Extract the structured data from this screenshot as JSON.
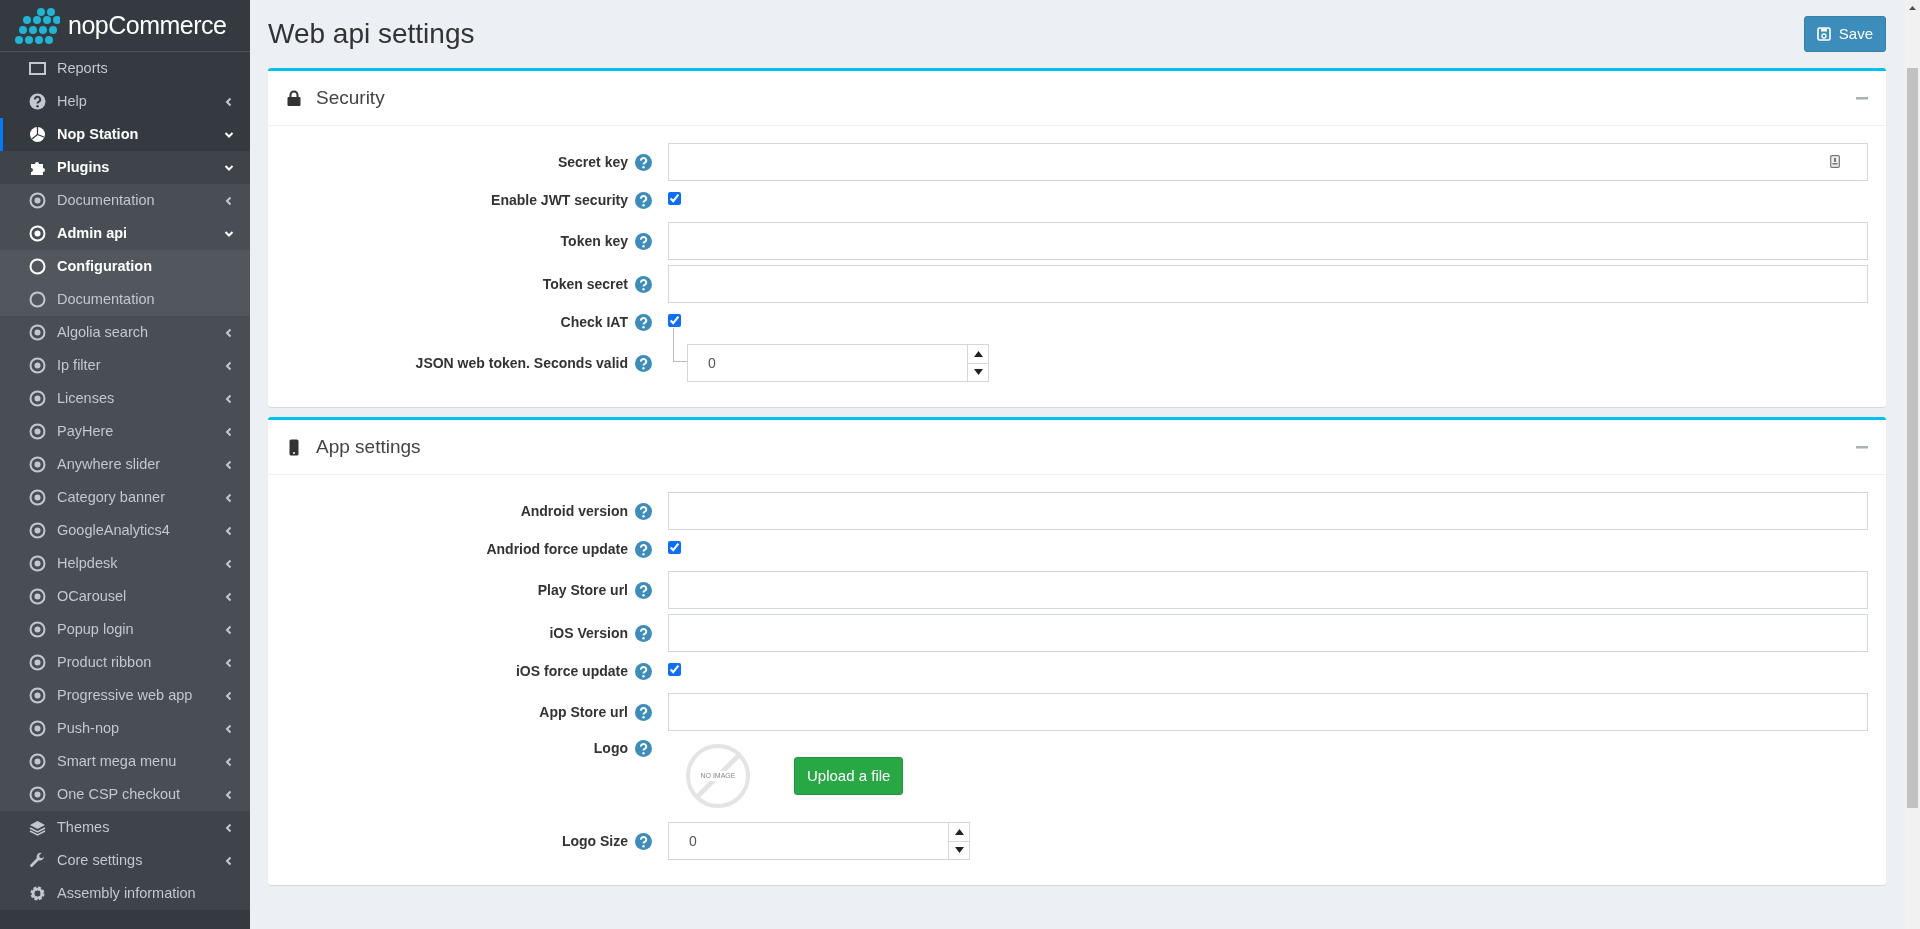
{
  "sidebar": {
    "logo": "nopCommerce",
    "items": [
      {
        "label": "Reports",
        "kind": "chart",
        "active": false
      },
      {
        "label": "Help",
        "kind": "question",
        "active": false,
        "expanded": false
      },
      {
        "label": "Nop Station",
        "kind": "pie",
        "active": true,
        "expanded": true,
        "children": [
          {
            "label": "Plugins",
            "kind": "puzzle",
            "active": true,
            "expanded": true,
            "children": [
              {
                "label": "Documentation",
                "kind": "plugin",
                "active": false,
                "expanded": false
              },
              {
                "label": "Admin api",
                "kind": "plugin",
                "active": true,
                "expanded": true,
                "children": [
                  {
                    "label": "Configuration",
                    "kind": "page",
                    "active": true
                  },
                  {
                    "label": "Documentation",
                    "kind": "page",
                    "active": false
                  }
                ]
              },
              {
                "label": "Algolia search",
                "kind": "plugin",
                "active": false,
                "expanded": false
              },
              {
                "label": "Ip filter",
                "kind": "plugin",
                "active": false,
                "expanded": false
              },
              {
                "label": "Licenses",
                "kind": "plugin",
                "active": false,
                "expanded": false
              },
              {
                "label": "PayHere",
                "kind": "plugin",
                "active": false,
                "expanded": false
              },
              {
                "label": "Anywhere slider",
                "kind": "plugin",
                "active": false,
                "expanded": false
              },
              {
                "label": "Category banner",
                "kind": "plugin",
                "active": false,
                "expanded": false
              },
              {
                "label": "GoogleAnalytics4",
                "kind": "plugin",
                "active": false,
                "expanded": false
              },
              {
                "label": "Helpdesk",
                "kind": "plugin",
                "active": false,
                "expanded": false
              },
              {
                "label": "OCarousel",
                "kind": "plugin",
                "active": false,
                "expanded": false
              },
              {
                "label": "Popup login",
                "kind": "plugin",
                "active": false,
                "expanded": false
              },
              {
                "label": "Product ribbon",
                "kind": "plugin",
                "active": false,
                "expanded": false
              },
              {
                "label": "Progressive web app",
                "kind": "plugin",
                "active": false,
                "expanded": false
              },
              {
                "label": "Push-nop",
                "kind": "plugin",
                "active": false,
                "expanded": false
              },
              {
                "label": "Smart mega menu",
                "kind": "plugin",
                "active": false,
                "expanded": false
              },
              {
                "label": "One CSP checkout",
                "kind": "plugin",
                "active": false,
                "expanded": false
              }
            ]
          },
          {
            "label": "Themes",
            "kind": "themes",
            "active": false,
            "expanded": false
          },
          {
            "label": "Core settings",
            "kind": "settings",
            "active": false,
            "expanded": false
          },
          {
            "label": "Assembly information",
            "kind": "info",
            "active": false
          }
        ]
      }
    ]
  },
  "page": {
    "title": "Web api settings",
    "save_button": "Save"
  },
  "panels": [
    {
      "title": "Security",
      "kind": "security",
      "fields": [
        {
          "label": "Secret key",
          "kind": "secret"
        },
        {
          "label": "Enable JWT security",
          "kind": "checkbox",
          "checked": true
        },
        {
          "label": "Token key",
          "kind": "text"
        },
        {
          "label": "Token secret",
          "kind": "text"
        },
        {
          "label": "Check IAT",
          "kind": "checkbox",
          "checked": true,
          "children": [
            {
              "label": "JSON web token. Seconds valid",
              "kind": "number",
              "value": "0"
            }
          ]
        }
      ]
    },
    {
      "title": "App settings",
      "kind": "app",
      "fields": [
        {
          "label": "Android version",
          "kind": "text"
        },
        {
          "label": "Andriod force update",
          "kind": "checkbox",
          "checked": true
        },
        {
          "label": "Play Store url",
          "kind": "text"
        },
        {
          "label": "iOS Version",
          "kind": "text"
        },
        {
          "label": "iOS force update",
          "kind": "checkbox",
          "checked": true
        },
        {
          "label": "App Store url",
          "kind": "text"
        },
        {
          "label": "Logo",
          "kind": "picture",
          "placeholder_text": "NO IMAGE",
          "button": "Upload a file"
        },
        {
          "label": "Logo Size",
          "kind": "number",
          "value": "0"
        }
      ]
    }
  ]
}
